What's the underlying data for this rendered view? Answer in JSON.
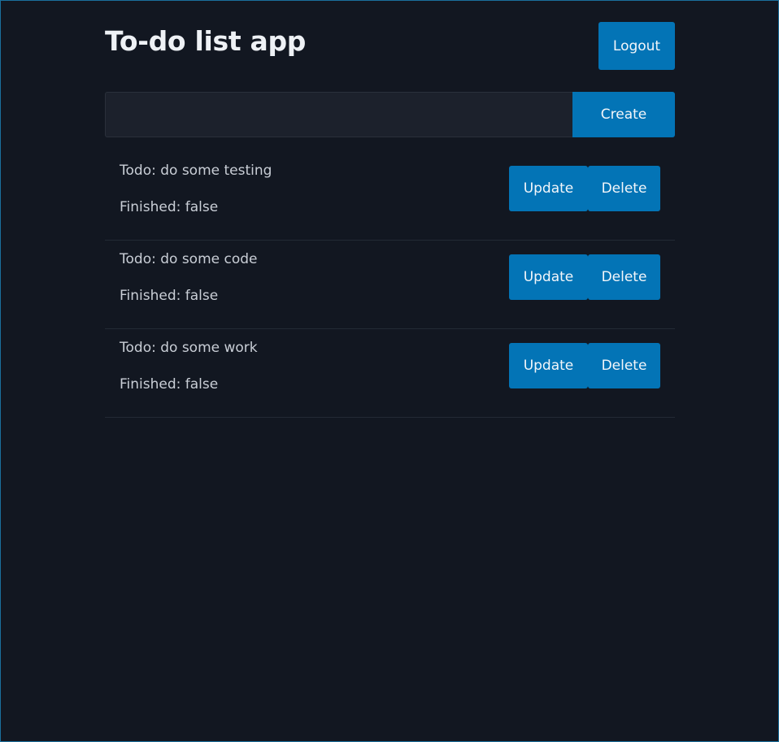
{
  "header": {
    "title": "To-do list app",
    "logout_label": "Logout"
  },
  "create": {
    "input_value": "",
    "placeholder": "",
    "button_label": "Create"
  },
  "todos": [
    {
      "text": "Todo: do some testing",
      "finished": "Finished: false",
      "update_label": "Update",
      "delete_label": "Delete"
    },
    {
      "text": "Todo: do some code",
      "finished": "Finished: false",
      "update_label": "Update",
      "delete_label": "Delete"
    },
    {
      "text": "Todo: do some work",
      "finished": "Finished: false",
      "update_label": "Update",
      "delete_label": "Delete"
    }
  ],
  "colors": {
    "background": "#121721",
    "accent": "#0374b6",
    "input_bg": "#1c212c",
    "text": "#c9ced6",
    "title": "#eef1f5"
  }
}
